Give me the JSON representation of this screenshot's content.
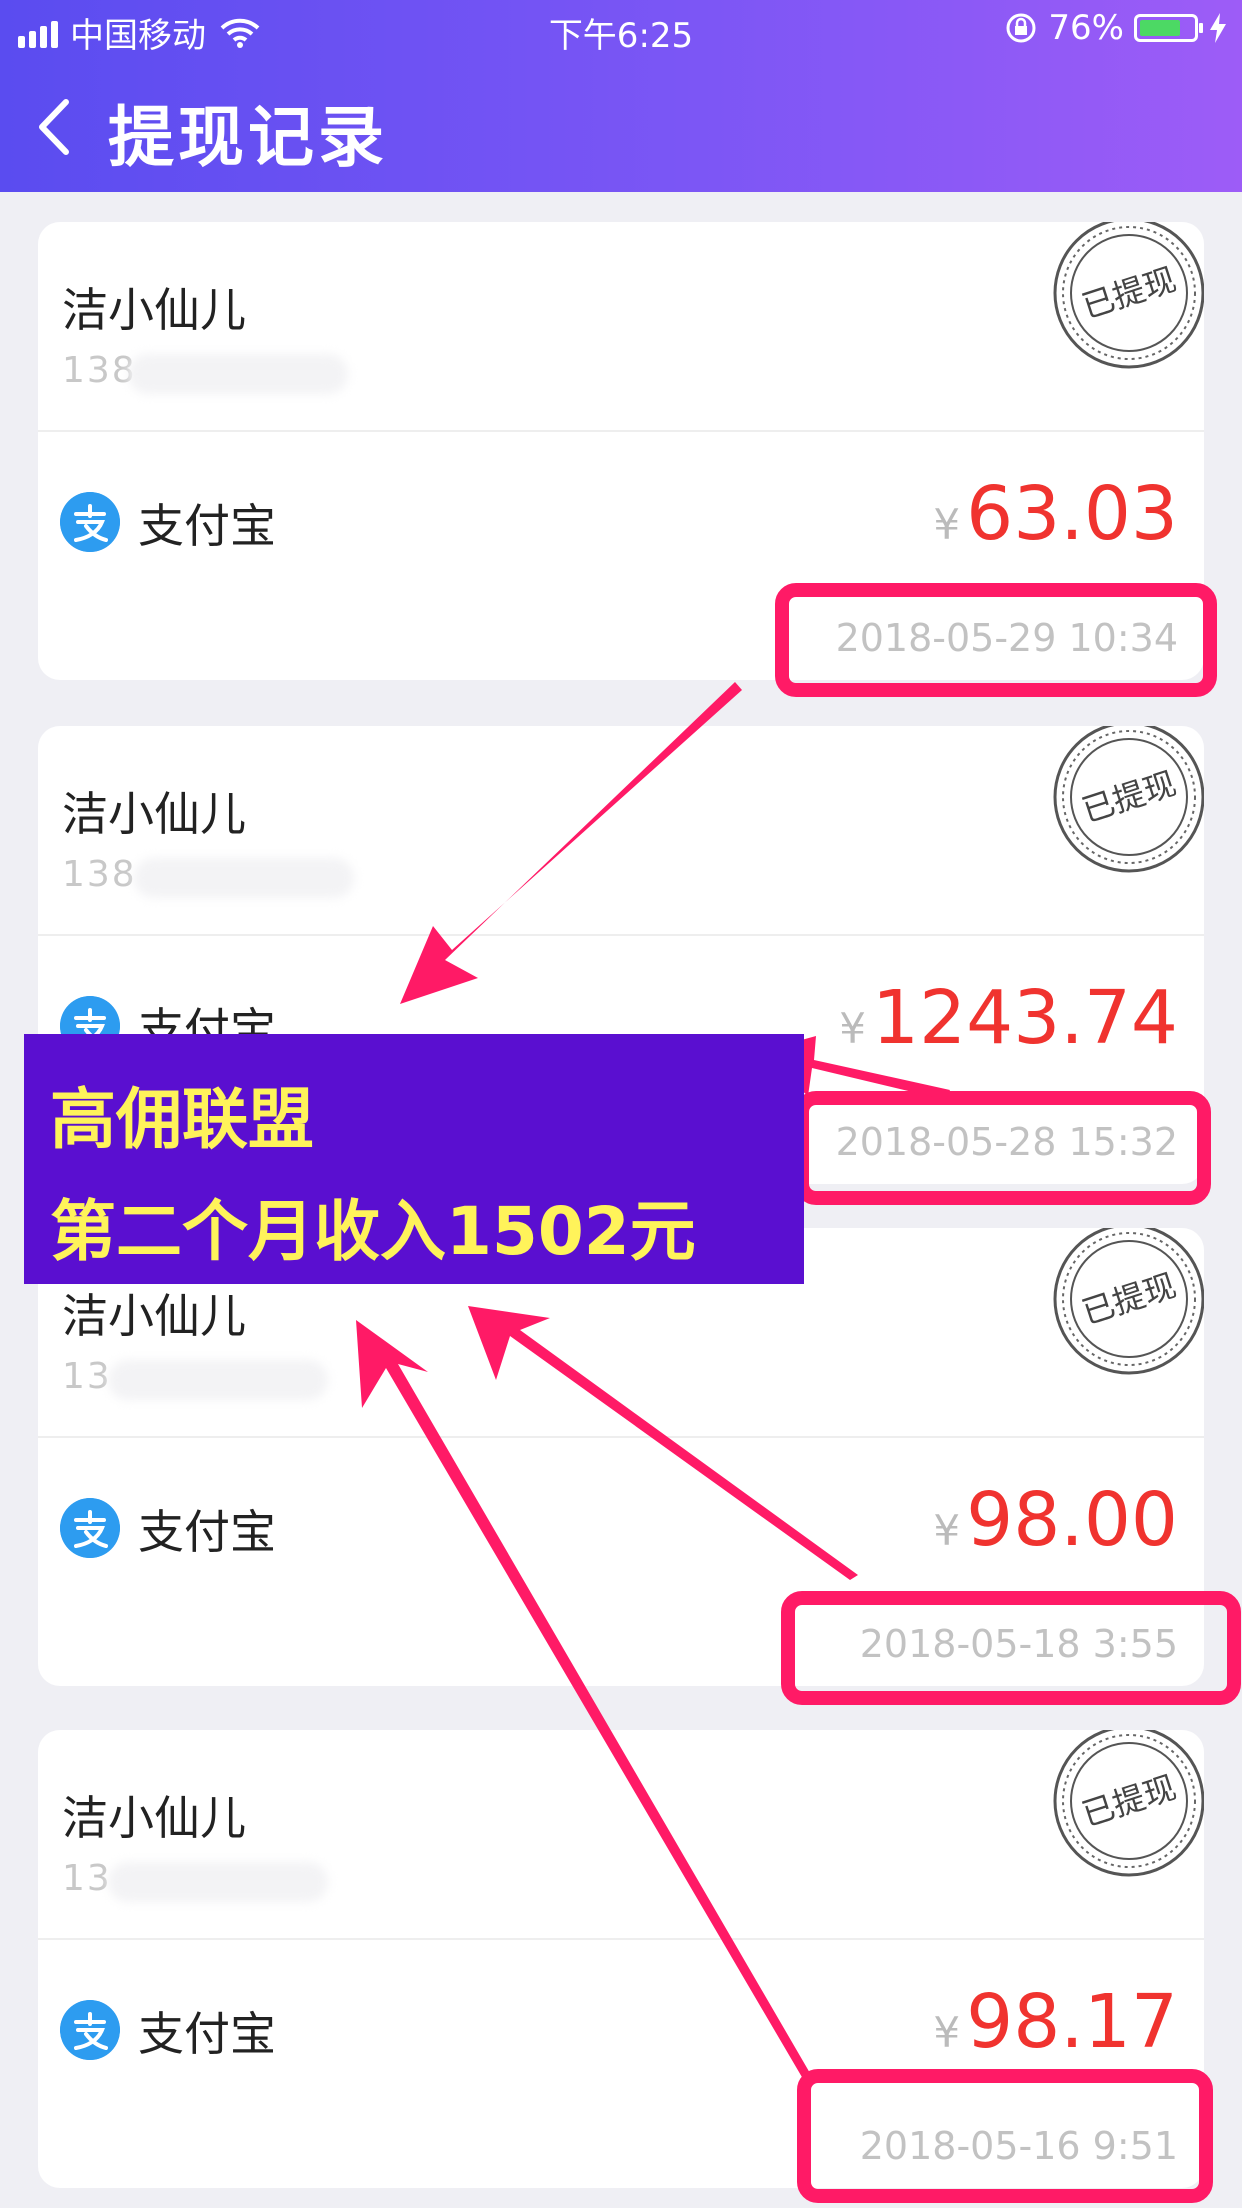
{
  "status_bar": {
    "carrier": "中国移动",
    "time": "下午6:25",
    "battery_percent": "76%",
    "battery_level": 0.76
  },
  "header": {
    "title": "提现记录",
    "back_icon": "chevron-left-icon"
  },
  "records": [
    {
      "name": "洁小仙儿",
      "phone_visible": "138",
      "stamp": "已提现",
      "method": "支付宝",
      "currency": "¥",
      "amount": "63.03",
      "datetime": "2018-05-29 10:34"
    },
    {
      "name": "洁小仙儿",
      "phone_visible": "138",
      "stamp": "已提现",
      "method": "支付宝",
      "currency": "¥",
      "amount": "1243.74",
      "datetime": "2018-05-28 15:32"
    },
    {
      "name": "洁小仙儿",
      "phone_visible": "13",
      "stamp": "已提现",
      "method": "支付宝",
      "currency": "¥",
      "amount": "98.00",
      "datetime": "2018-05-18 3:55"
    },
    {
      "name": "洁小仙儿",
      "phone_visible": "13",
      "stamp": "已提现",
      "method": "支付宝",
      "currency": "¥",
      "amount": "98.17",
      "datetime": "2018-05-16 9:51"
    }
  ],
  "annotation": {
    "line1": "高佣联盟",
    "line2": "第二个月收入1502元",
    "highlight_color": "#ff1a66",
    "banner_color": "#5a0fd0",
    "text_color": "#fff35a"
  },
  "colors": {
    "header_start": "#5a4cf0",
    "header_end": "#9d5cf7",
    "amount": "#f0332f",
    "alipay": "#2d9cf0"
  }
}
